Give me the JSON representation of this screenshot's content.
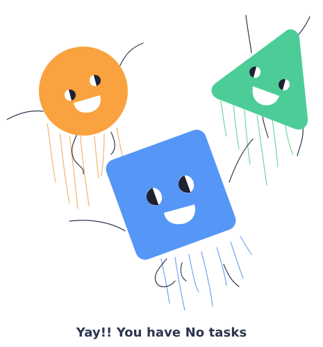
{
  "empty_state": {
    "message": "Yay!! You have No tasks",
    "illustration": {
      "characters": [
        "circle-character",
        "triangle-character",
        "square-character"
      ],
      "colors": {
        "circle": "#F9A23F",
        "triangle": "#4CCD97",
        "square": "#5596F7",
        "circle_legs": "#F2B46A",
        "triangle_legs": "#6FD6A6",
        "square_legs": "#6FA3F5",
        "ink": "#2C3550"
      }
    },
    "text_color": "#2C3550"
  }
}
